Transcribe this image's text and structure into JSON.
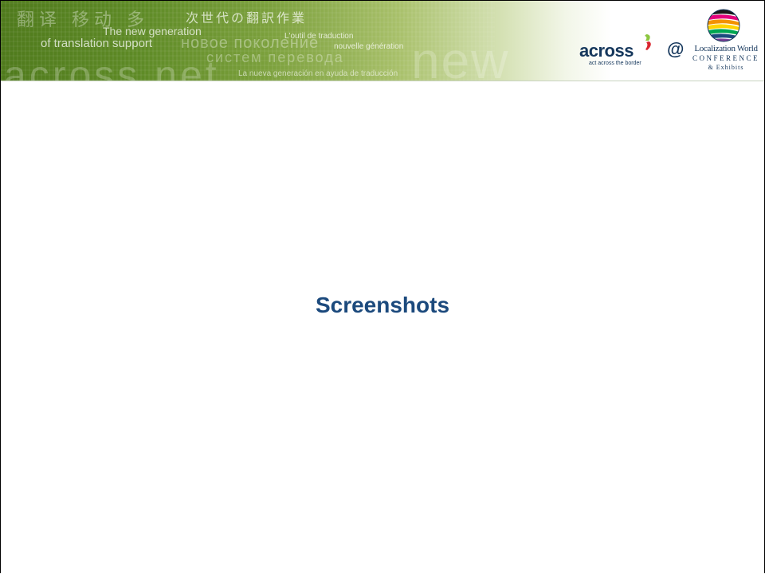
{
  "banner": {
    "cjk_left": "翻译 移动 多",
    "cjk_right": "次世代の翻訳作業",
    "new_generation": "The new generation",
    "of_translation_support": "of translation support",
    "russian_1": "новое поколение",
    "russian_2": "систем перевода",
    "french_1": "L'outil de traduction",
    "french_2": "nouvelle génération",
    "across_net": "across.net",
    "new_word": "new",
    "spanish": "La nueva generación en ayuda de traducción"
  },
  "logos": {
    "across_word": "across",
    "across_tagline": "act across the border",
    "at_sign": "@",
    "lw_name": "Localization World",
    "lw_conference": "CONFERENCE",
    "lw_exhibits": "& Exhibits"
  },
  "colors": {
    "brand_navy": "#15375c",
    "title_blue": "#1c4a7d",
    "banner_green": "#5e8a26",
    "comma_green": "#8cc63f",
    "comma_red": "#d9262e"
  },
  "slide": {
    "title": "Screenshots"
  }
}
